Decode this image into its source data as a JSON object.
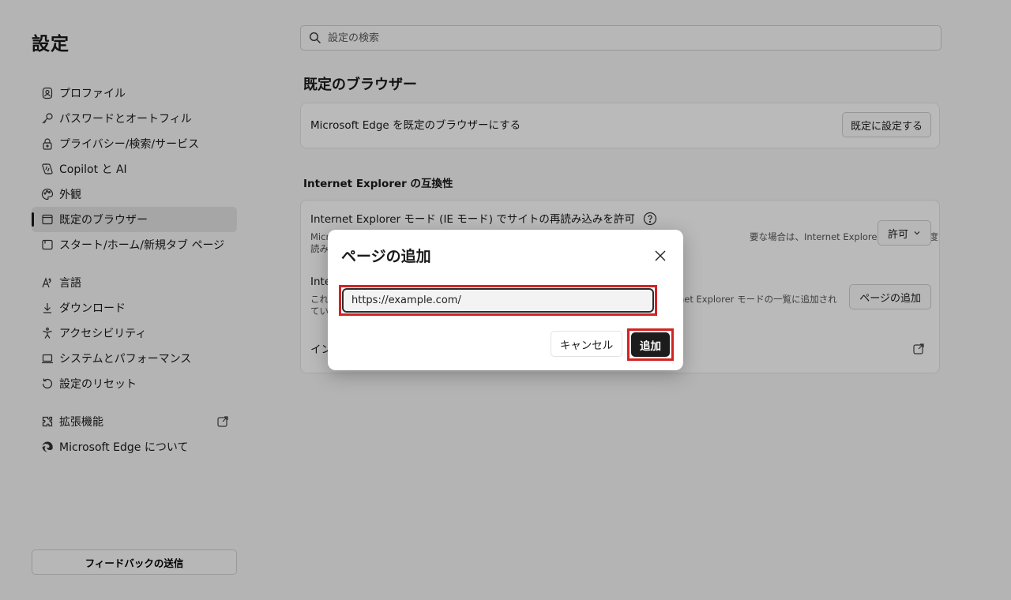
{
  "sidebar": {
    "title": "設定",
    "items": [
      {
        "label": "プロファイル",
        "icon": "profile-icon"
      },
      {
        "label": "パスワードとオートフィル",
        "icon": "key-icon"
      },
      {
        "label": "プライバシー/検索/サービス",
        "icon": "lock-icon"
      },
      {
        "label": "Copilot と AI",
        "icon": "copilot-icon"
      },
      {
        "label": "外観",
        "icon": "palette-icon"
      },
      {
        "label": "既定のブラウザー",
        "icon": "browser-icon",
        "active": true
      },
      {
        "label": "スタート/ホーム/新規タブ ページ",
        "icon": "home-icon"
      },
      {
        "label": "言語",
        "icon": "language-icon"
      },
      {
        "label": "ダウンロード",
        "icon": "download-icon"
      },
      {
        "label": "アクセシビリティ",
        "icon": "accessibility-icon"
      },
      {
        "label": "システムとパフォーマンス",
        "icon": "laptop-icon"
      },
      {
        "label": "設定のリセット",
        "icon": "reset-icon"
      },
      {
        "label": "拡張機能",
        "icon": "extensions-icon"
      },
      {
        "label": "Microsoft Edge について",
        "icon": "edge-icon"
      }
    ],
    "feedback_label": "フィードバックの送信"
  },
  "search": {
    "placeholder": "設定の検索"
  },
  "main": {
    "section_title": "既定のブラウザー",
    "default_card": {
      "text": "Microsoft Edge を既定のブラウザーにする",
      "button": "既定に設定する"
    },
    "ie_title": "Internet Explorer の互換性",
    "ie_reload": {
      "title": "Internet Explorer モード (IE モード) でサイトの再読み込みを許可",
      "desc_left_1": "Micr",
      "desc_right_1": "要な場合は、Internet Explorer モードで再度",
      "desc_left_2": "読み",
      "dropdown": "許可"
    },
    "ie_pages": {
      "title": "Inte",
      "desc_left_1": "これ",
      "desc_right_1": "net Explorer モードの一覧に追加され",
      "desc_left_2": "てい",
      "button": "ページの追加"
    },
    "ie_third_row": "イン"
  },
  "dialog": {
    "title": "ページの追加",
    "url_value": "https://example.com/",
    "cancel_label": "キャンセル",
    "add_label": "追加"
  },
  "colors": {
    "highlight": "#d32222",
    "primary_button": "#1c1c1c"
  }
}
